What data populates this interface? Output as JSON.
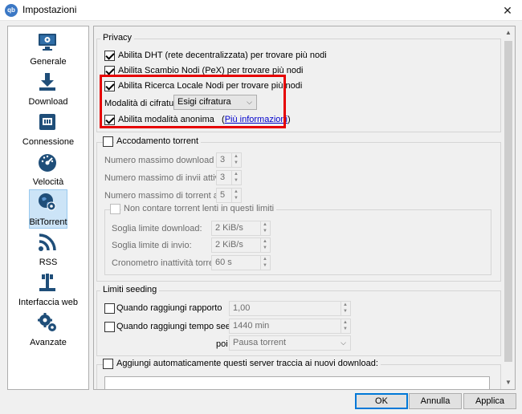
{
  "window": {
    "title": "Impostazioni",
    "app_icon_text": "qb",
    "close_glyph": "✕"
  },
  "sidebar": {
    "items": [
      {
        "label": "Generale",
        "icon": "monitor-gear-icon"
      },
      {
        "label": "Download",
        "icon": "download-icon"
      },
      {
        "label": "Connessione",
        "icon": "network-icon"
      },
      {
        "label": "Velocità",
        "icon": "speedometer-icon"
      },
      {
        "label": "BitTorrent",
        "icon": "globe-gear-icon",
        "selected": true
      },
      {
        "label": "RSS",
        "icon": "rss-icon"
      },
      {
        "label": "Interfaccia web",
        "icon": "web-interface-icon"
      },
      {
        "label": "Avanzate",
        "icon": "gears-icon"
      }
    ]
  },
  "privacy": {
    "title": "Privacy",
    "dht": {
      "label": "Abilita DHT (rete decentralizzata) per trovare più nodi",
      "checked": true
    },
    "pex": {
      "label": "Abilita Scambio Nodi (PeX) per trovare più nodi",
      "checked": true
    },
    "lsd": {
      "label": "Abilita Ricerca Locale Nodi per trovare più nodi",
      "checked": true
    },
    "encryption": {
      "label": "Modalità di cifratura:",
      "value": "Esigi cifratura"
    },
    "anonymous": {
      "label": "Abilita modalità anonima",
      "checked": true,
      "link_open": "(",
      "link_text": "Più informazioni",
      "link_close": ")"
    }
  },
  "queueing": {
    "title": "Accodamento torrent",
    "checked": false,
    "max_downloads": {
      "label": "Numero massimo download attivi:",
      "value": "3"
    },
    "max_uploads": {
      "label": "Numero massimo di invii attivi:",
      "value": "3"
    },
    "max_torrents": {
      "label": "Numero massimo di torrent attivi:",
      "value": "5"
    },
    "slow": {
      "title": "Non contare torrent lenti in questi limiti",
      "checked": false,
      "download_threshold": {
        "label": "Soglia limite download:",
        "value": "2 KiB/s"
      },
      "upload_threshold": {
        "label": "Soglia limite di invio:",
        "value": "2 KiB/s"
      },
      "inactivity_timer": {
        "label": "Cronometro inattività torrent:",
        "value": "60 s"
      }
    }
  },
  "seeding": {
    "title": "Limiti seeding",
    "ratio": {
      "label": "Quando raggiungi rapporto",
      "value": "1,00",
      "checked": false
    },
    "seed_time": {
      "label": "Quando raggiungi tempo seeding",
      "value": "1440 min",
      "checked": false
    },
    "then": {
      "label": "poi",
      "value": "Pausa torrent"
    }
  },
  "trackers": {
    "label": "Aggiungi automaticamente questi server traccia ai nuovi download:",
    "checked": false
  },
  "buttons": {
    "ok": "OK",
    "cancel": "Annulla",
    "apply": "Applica"
  },
  "glyphs": {
    "dropdown": "⌵",
    "spin_up": "▲",
    "spin_down": "▼",
    "scroll_up": "▲",
    "scroll_down": "▼"
  },
  "colors": {
    "highlight_border": "#e60000",
    "selection_bg": "#cce4f7",
    "link": "#0000cc",
    "icon_blue": "#1f4e79"
  }
}
